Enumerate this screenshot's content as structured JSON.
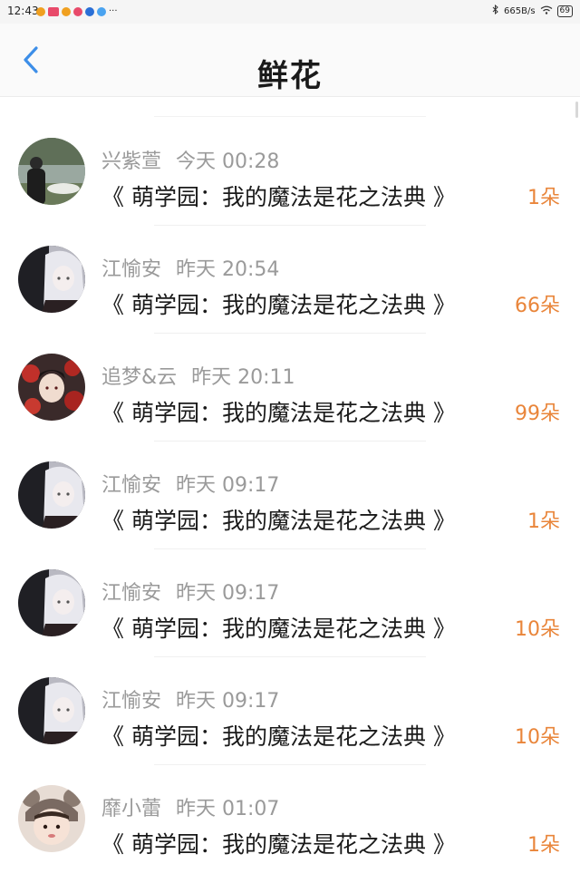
{
  "status_bar": {
    "time": "12:43",
    "ellipsis": "···",
    "network_speed": "665B/s",
    "battery": "69"
  },
  "header": {
    "title": "鲜花"
  },
  "gifts": [
    {
      "user": "兴紫萱",
      "time": "今天 00:28",
      "book": "《 萌学园：我的魔法是花之法典 》",
      "amount": "1朵"
    },
    {
      "user": "江愉安",
      "time": "昨天 20:54",
      "book": "《 萌学园：我的魔法是花之法典 》",
      "amount": "66朵"
    },
    {
      "user": "追梦&云",
      "time": "昨天 20:11",
      "book": "《 萌学园：我的魔法是花之法典 》",
      "amount": "99朵"
    },
    {
      "user": "江愉安",
      "time": "昨天 09:17",
      "book": "《 萌学园：我的魔法是花之法典 》",
      "amount": "1朵"
    },
    {
      "user": "江愉安",
      "time": "昨天 09:17",
      "book": "《 萌学园：我的魔法是花之法典 》",
      "amount": "10朵"
    },
    {
      "user": "江愉安",
      "time": "昨天 09:17",
      "book": "《 萌学园：我的魔法是花之法典 》",
      "amount": "10朵"
    },
    {
      "user": "靡小蕾",
      "time": "昨天 01:07",
      "book": "《 萌学园：我的魔法是花之法典 》",
      "amount": "1朵"
    }
  ],
  "avatars": [
    "photo-avatar-man-by-lake",
    "anime-girl-avatar",
    "red-anime-avatar",
    "anime-girl-avatar",
    "anime-girl-avatar",
    "anime-girl-avatar",
    "child-photo-avatar"
  ],
  "colors": {
    "accent_orange": "#e9853a",
    "back_blue": "#3d8ee8",
    "meta_gray": "#9a9a9a"
  }
}
